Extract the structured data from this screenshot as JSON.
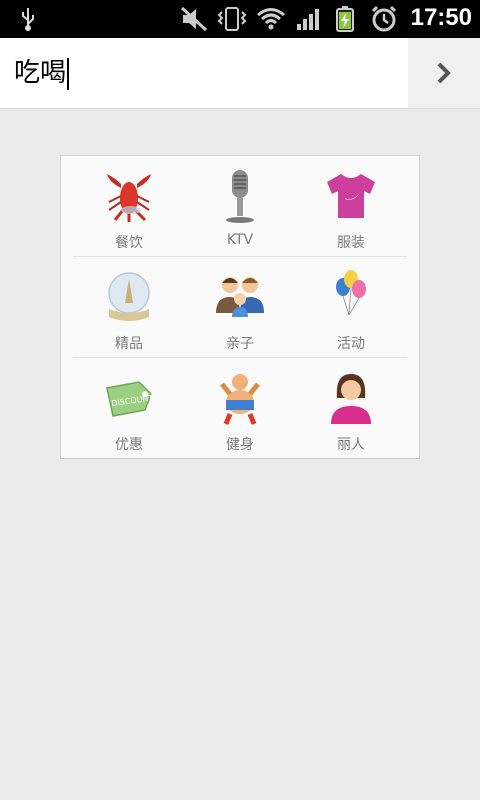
{
  "status": {
    "time": "17:50"
  },
  "search": {
    "value": "吃喝"
  },
  "categories": [
    {
      "label": "餐饮",
      "icon": "lobster-icon"
    },
    {
      "label": "KTV",
      "icon": "microphone-icon"
    },
    {
      "label": "服装",
      "icon": "tshirt-icon"
    },
    {
      "label": "精品",
      "icon": "snow-globe-icon"
    },
    {
      "label": "亲子",
      "icon": "family-icon"
    },
    {
      "label": "活动",
      "icon": "balloons-icon"
    },
    {
      "label": "优惠",
      "icon": "discount-tag-icon"
    },
    {
      "label": "健身",
      "icon": "fitness-icon"
    },
    {
      "label": "丽人",
      "icon": "woman-icon"
    }
  ]
}
